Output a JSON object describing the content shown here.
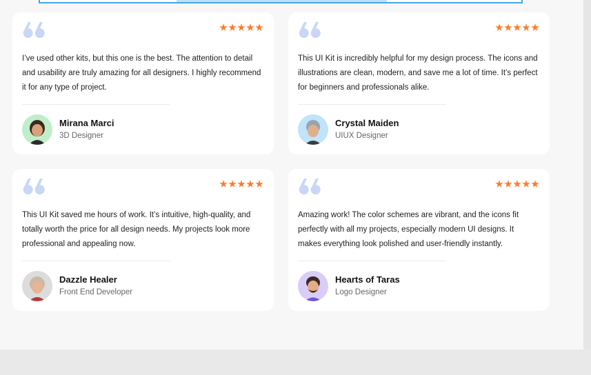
{
  "accent_colors": {
    "star": "#ff7a29",
    "quote": "#c9d7f6"
  },
  "testimonials": [
    {
      "text": "I’ve used other kits, but this one is the best. The attention to detail and usability are truly amazing for all designers. I highly recommend it for any type of project.",
      "name": "Mirana Marci",
      "role": "3D Designer",
      "rating": 5,
      "avatar_bg": "#bfeec8"
    },
    {
      "text": "This UI Kit is incredibly helpful for my design process. The icons and illustrations are clean, modern, and save me a lot of time. It’s perfect for beginners and professionals alike.",
      "name": "Crystal Maiden",
      "role": "UIUX Designer",
      "rating": 5,
      "avatar_bg": "#bfe4fb"
    },
    {
      "text": "This UI Kit saved me hours of work. It’s intuitive, high-quality, and totally worth the price for all design needs. My projects look more professional and appealing now.",
      "name": "Dazzle Healer",
      "role": "Front End Developer",
      "rating": 5,
      "avatar_bg": "#dcdcdc"
    },
    {
      "text": "Amazing work! The color schemes are vibrant, and the icons fit perfectly with all my projects, especially modern UI designs. It makes everything look polished and user-friendly instantly.",
      "name": "Hearts of Taras",
      "role": "Logo Designer",
      "rating": 5,
      "avatar_bg": "#d9cdf8"
    }
  ]
}
